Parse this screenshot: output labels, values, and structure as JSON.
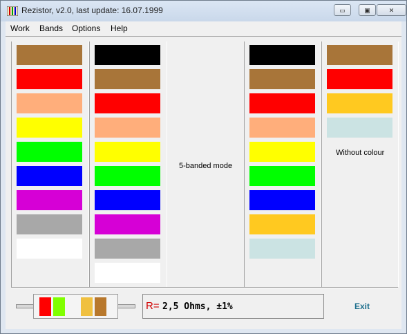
{
  "window": {
    "title": "Rezistor, v2.0, last update: 16.07.1999",
    "controls": {
      "minimize": "▭",
      "maximize": "▣",
      "close": "✕"
    }
  },
  "menu": [
    "Work",
    "Bands",
    "Options",
    "Help"
  ],
  "panels": {
    "band1": [
      "#a87539",
      "#ff0000",
      "#ffae7b",
      "#ffff00",
      "#00ff00",
      "#0000ff",
      "#d600d6",
      "#a8a8a8",
      "#ffffff"
    ],
    "band2": [
      "#000000",
      "#a87539",
      "#ff0000",
      "#ffae7b",
      "#ffff00",
      "#00ff00",
      "#0000ff",
      "#d600d6",
      "#a8a8a8",
      "#ffffff"
    ],
    "multiplier": [
      "#000000",
      "#a87539",
      "#ff0000",
      "#ffae7b",
      "#ffff00",
      "#00ff00",
      "#0000ff",
      "#ffc920",
      "#cbe3e3"
    ],
    "tolerance": [
      "#a87539",
      "#ff0000",
      "#ffc920",
      "#cbe3e3"
    ]
  },
  "labels": {
    "mode": "5-banded mode",
    "without_colour": "Without colour"
  },
  "resistor": {
    "bands": [
      "#ff0000",
      "#80ff00",
      "#f4f4f4",
      "#f0c040",
      "#b8782c"
    ]
  },
  "result": {
    "prefix": "R=",
    "value": "2,5 Ohms, ±1%"
  },
  "exit_label": "Exit"
}
